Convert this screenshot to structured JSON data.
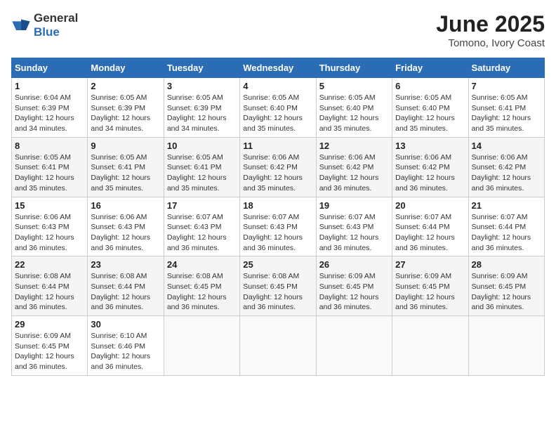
{
  "header": {
    "logo_general": "General",
    "logo_blue": "Blue",
    "month_title": "June 2025",
    "location": "Tomono, Ivory Coast"
  },
  "calendar": {
    "days_of_week": [
      "Sunday",
      "Monday",
      "Tuesday",
      "Wednesday",
      "Thursday",
      "Friday",
      "Saturday"
    ],
    "weeks": [
      [
        {
          "day": "1",
          "sunrise": "6:04 AM",
          "sunset": "6:39 PM",
          "daylight": "12 hours and 34 minutes."
        },
        {
          "day": "2",
          "sunrise": "6:05 AM",
          "sunset": "6:39 PM",
          "daylight": "12 hours and 34 minutes."
        },
        {
          "day": "3",
          "sunrise": "6:05 AM",
          "sunset": "6:39 PM",
          "daylight": "12 hours and 34 minutes."
        },
        {
          "day": "4",
          "sunrise": "6:05 AM",
          "sunset": "6:40 PM",
          "daylight": "12 hours and 35 minutes."
        },
        {
          "day": "5",
          "sunrise": "6:05 AM",
          "sunset": "6:40 PM",
          "daylight": "12 hours and 35 minutes."
        },
        {
          "day": "6",
          "sunrise": "6:05 AM",
          "sunset": "6:40 PM",
          "daylight": "12 hours and 35 minutes."
        },
        {
          "day": "7",
          "sunrise": "6:05 AM",
          "sunset": "6:41 PM",
          "daylight": "12 hours and 35 minutes."
        }
      ],
      [
        {
          "day": "8",
          "sunrise": "6:05 AM",
          "sunset": "6:41 PM",
          "daylight": "12 hours and 35 minutes."
        },
        {
          "day": "9",
          "sunrise": "6:05 AM",
          "sunset": "6:41 PM",
          "daylight": "12 hours and 35 minutes."
        },
        {
          "day": "10",
          "sunrise": "6:05 AM",
          "sunset": "6:41 PM",
          "daylight": "12 hours and 35 minutes."
        },
        {
          "day": "11",
          "sunrise": "6:06 AM",
          "sunset": "6:42 PM",
          "daylight": "12 hours and 35 minutes."
        },
        {
          "day": "12",
          "sunrise": "6:06 AM",
          "sunset": "6:42 PM",
          "daylight": "12 hours and 36 minutes."
        },
        {
          "day": "13",
          "sunrise": "6:06 AM",
          "sunset": "6:42 PM",
          "daylight": "12 hours and 36 minutes."
        },
        {
          "day": "14",
          "sunrise": "6:06 AM",
          "sunset": "6:42 PM",
          "daylight": "12 hours and 36 minutes."
        }
      ],
      [
        {
          "day": "15",
          "sunrise": "6:06 AM",
          "sunset": "6:43 PM",
          "daylight": "12 hours and 36 minutes."
        },
        {
          "day": "16",
          "sunrise": "6:06 AM",
          "sunset": "6:43 PM",
          "daylight": "12 hours and 36 minutes."
        },
        {
          "day": "17",
          "sunrise": "6:07 AM",
          "sunset": "6:43 PM",
          "daylight": "12 hours and 36 minutes."
        },
        {
          "day": "18",
          "sunrise": "6:07 AM",
          "sunset": "6:43 PM",
          "daylight": "12 hours and 36 minutes."
        },
        {
          "day": "19",
          "sunrise": "6:07 AM",
          "sunset": "6:43 PM",
          "daylight": "12 hours and 36 minutes."
        },
        {
          "day": "20",
          "sunrise": "6:07 AM",
          "sunset": "6:44 PM",
          "daylight": "12 hours and 36 minutes."
        },
        {
          "day": "21",
          "sunrise": "6:07 AM",
          "sunset": "6:44 PM",
          "daylight": "12 hours and 36 minutes."
        }
      ],
      [
        {
          "day": "22",
          "sunrise": "6:08 AM",
          "sunset": "6:44 PM",
          "daylight": "12 hours and 36 minutes."
        },
        {
          "day": "23",
          "sunrise": "6:08 AM",
          "sunset": "6:44 PM",
          "daylight": "12 hours and 36 minutes."
        },
        {
          "day": "24",
          "sunrise": "6:08 AM",
          "sunset": "6:45 PM",
          "daylight": "12 hours and 36 minutes."
        },
        {
          "day": "25",
          "sunrise": "6:08 AM",
          "sunset": "6:45 PM",
          "daylight": "12 hours and 36 minutes."
        },
        {
          "day": "26",
          "sunrise": "6:09 AM",
          "sunset": "6:45 PM",
          "daylight": "12 hours and 36 minutes."
        },
        {
          "day": "27",
          "sunrise": "6:09 AM",
          "sunset": "6:45 PM",
          "daylight": "12 hours and 36 minutes."
        },
        {
          "day": "28",
          "sunrise": "6:09 AM",
          "sunset": "6:45 PM",
          "daylight": "12 hours and 36 minutes."
        }
      ],
      [
        {
          "day": "29",
          "sunrise": "6:09 AM",
          "sunset": "6:45 PM",
          "daylight": "12 hours and 36 minutes."
        },
        {
          "day": "30",
          "sunrise": "6:10 AM",
          "sunset": "6:46 PM",
          "daylight": "12 hours and 36 minutes."
        },
        null,
        null,
        null,
        null,
        null
      ]
    ]
  },
  "labels": {
    "sunrise": "Sunrise:",
    "sunset": "Sunset:",
    "daylight": "Daylight:"
  }
}
